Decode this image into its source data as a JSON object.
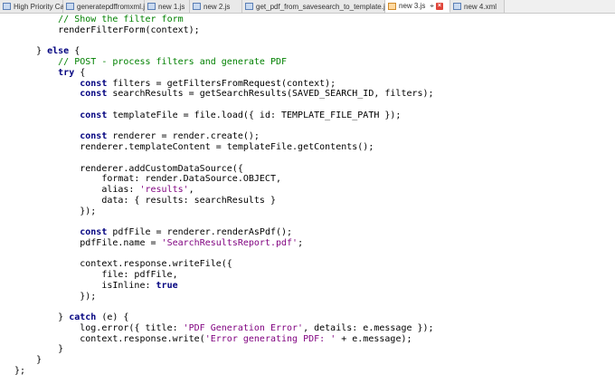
{
  "tabs": [
    {
      "label": "High Priority Cases.js",
      "active": false
    },
    {
      "label": "generatepdffromxml.js",
      "active": false
    },
    {
      "label": "new 1.js",
      "active": false
    },
    {
      "label": "new 2.js",
      "active": false
    },
    {
      "label": "get_pdf_from_savesearch_to_template.js",
      "active": false
    },
    {
      "label": "new 3.js",
      "active": true
    },
    {
      "label": "new 4.xml",
      "active": false
    }
  ],
  "code_lines": [
    {
      "indent": 8,
      "tokens": [
        {
          "t": "// Show the filter form",
          "c": "c"
        }
      ]
    },
    {
      "indent": 8,
      "tokens": [
        {
          "t": "renderFilterForm(context);",
          "c": ""
        }
      ]
    },
    {
      "indent": 0,
      "tokens": [
        {
          "t": "",
          "c": ""
        }
      ]
    },
    {
      "indent": 4,
      "tokens": [
        {
          "t": "} ",
          "c": ""
        },
        {
          "t": "else",
          "c": "k"
        },
        {
          "t": " {",
          "c": ""
        }
      ]
    },
    {
      "indent": 8,
      "tokens": [
        {
          "t": "// POST - process filters and generate PDF",
          "c": "c"
        }
      ]
    },
    {
      "indent": 8,
      "tokens": [
        {
          "t": "try",
          "c": "k"
        },
        {
          "t": " {",
          "c": ""
        }
      ]
    },
    {
      "indent": 12,
      "tokens": [
        {
          "t": "const",
          "c": "k"
        },
        {
          "t": " filters = getFiltersFromRequest(context);",
          "c": ""
        }
      ]
    },
    {
      "indent": 12,
      "tokens": [
        {
          "t": "const",
          "c": "k"
        },
        {
          "t": " searchResults = getSearchResults(SAVED_SEARCH_ID, filters);",
          "c": ""
        }
      ]
    },
    {
      "indent": 0,
      "tokens": [
        {
          "t": "",
          "c": ""
        }
      ]
    },
    {
      "indent": 12,
      "tokens": [
        {
          "t": "const",
          "c": "k"
        },
        {
          "t": " templateFile = file.load({ id: TEMPLATE_FILE_PATH });",
          "c": ""
        }
      ]
    },
    {
      "indent": 0,
      "tokens": [
        {
          "t": "",
          "c": ""
        }
      ]
    },
    {
      "indent": 12,
      "tokens": [
        {
          "t": "const",
          "c": "k"
        },
        {
          "t": " renderer = render.create();",
          "c": ""
        }
      ]
    },
    {
      "indent": 12,
      "tokens": [
        {
          "t": "renderer.templateContent = templateFile.getContents();",
          "c": ""
        }
      ]
    },
    {
      "indent": 0,
      "tokens": [
        {
          "t": "",
          "c": ""
        }
      ]
    },
    {
      "indent": 12,
      "tokens": [
        {
          "t": "renderer.addCustomDataSource({",
          "c": ""
        }
      ]
    },
    {
      "indent": 16,
      "tokens": [
        {
          "t": "format: render.DataSource.OBJECT,",
          "c": ""
        }
      ]
    },
    {
      "indent": 16,
      "tokens": [
        {
          "t": "alias: ",
          "c": ""
        },
        {
          "t": "'results'",
          "c": "s"
        },
        {
          "t": ",",
          "c": ""
        }
      ]
    },
    {
      "indent": 16,
      "tokens": [
        {
          "t": "data: { results: searchResults }",
          "c": ""
        }
      ]
    },
    {
      "indent": 12,
      "tokens": [
        {
          "t": "});",
          "c": ""
        }
      ]
    },
    {
      "indent": 0,
      "tokens": [
        {
          "t": "",
          "c": ""
        }
      ]
    },
    {
      "indent": 12,
      "tokens": [
        {
          "t": "const",
          "c": "k"
        },
        {
          "t": " pdfFile = renderer.renderAsPdf();",
          "c": ""
        }
      ]
    },
    {
      "indent": 12,
      "tokens": [
        {
          "t": "pdfFile.name = ",
          "c": ""
        },
        {
          "t": "'SearchResultsReport.pdf'",
          "c": "s"
        },
        {
          "t": ";",
          "c": ""
        }
      ]
    },
    {
      "indent": 0,
      "tokens": [
        {
          "t": "",
          "c": ""
        }
      ]
    },
    {
      "indent": 12,
      "tokens": [
        {
          "t": "context.response.writeFile({",
          "c": ""
        }
      ]
    },
    {
      "indent": 16,
      "tokens": [
        {
          "t": "file: pdfFile,",
          "c": ""
        }
      ]
    },
    {
      "indent": 16,
      "tokens": [
        {
          "t": "isInline: ",
          "c": ""
        },
        {
          "t": "true",
          "c": "k"
        }
      ]
    },
    {
      "indent": 12,
      "tokens": [
        {
          "t": "});",
          "c": ""
        }
      ]
    },
    {
      "indent": 0,
      "tokens": [
        {
          "t": "",
          "c": ""
        }
      ]
    },
    {
      "indent": 8,
      "tokens": [
        {
          "t": "} ",
          "c": ""
        },
        {
          "t": "catch",
          "c": "k"
        },
        {
          "t": " (e) {",
          "c": ""
        }
      ]
    },
    {
      "indent": 12,
      "tokens": [
        {
          "t": "log.error({ title: ",
          "c": ""
        },
        {
          "t": "'PDF Generation Error'",
          "c": "s"
        },
        {
          "t": ", details: e.message });",
          "c": ""
        }
      ]
    },
    {
      "indent": 12,
      "tokens": [
        {
          "t": "context.response.write(",
          "c": ""
        },
        {
          "t": "'Error generating PDF: '",
          "c": "s"
        },
        {
          "t": " + e.message);",
          "c": ""
        }
      ]
    },
    {
      "indent": 8,
      "tokens": [
        {
          "t": "}",
          "c": ""
        }
      ]
    },
    {
      "indent": 4,
      "tokens": [
        {
          "t": "}",
          "c": ""
        }
      ]
    },
    {
      "indent": 0,
      "tokens": [
        {
          "t": "};",
          "c": ""
        }
      ]
    }
  ]
}
